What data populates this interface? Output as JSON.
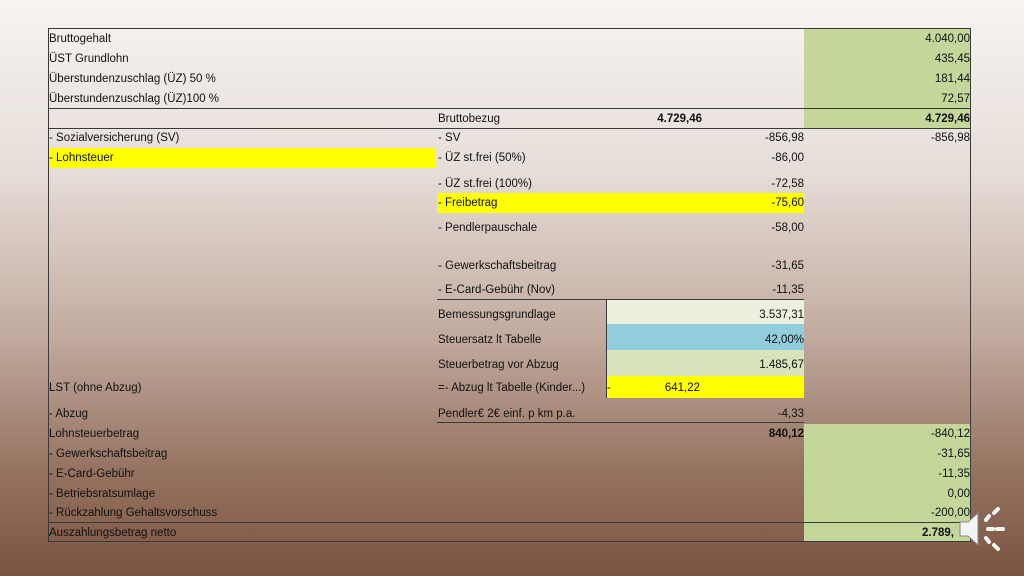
{
  "rows": {
    "brutto_label": "Bruttogehalt",
    "brutto_value": "4.040,00",
    "ust_label": "ÜST Grundlohn",
    "ust_value": "435,45",
    "uez50_label": "Überstundenzuschlag (ÜZ) 50 %",
    "uez50_value": "181,44",
    "uez100_label": "Überstundenzuschlag (ÜZ)100 %",
    "uez100_value": "72,57",
    "bruttobezug_label": "Bruttobezug",
    "bruttobezug_mid": "4.729,46",
    "bruttobezug_value": "4.729,46",
    "sv_label": "- Sozialversicherung (SV)",
    "sv_sub_label": "- SV",
    "sv_sub_value": "-856,98",
    "sv_value": "-856,98",
    "lohnsteuer_label": "- Lohnsteuer",
    "uez50frei_label": "- ÜZ st.frei (50%)",
    "uez50frei_value": "-86,00",
    "uez100frei_label": "- ÜZ st.frei (100%)",
    "uez100frei_value": "-72,58",
    "freibetrag_label": "- Freibetrag",
    "freibetrag_value": "-75,60",
    "pendler_label": "- Pendlerpauschale",
    "pendler_value": "-58,00",
    "gewerk_sub_label": "- Gewerkschaftsbeitrag",
    "gewerk_sub_value": "-31,65",
    "ecard_sub_label": "- E-Card-Gebühr (Nov)",
    "ecard_sub_value": "-11,35",
    "bemessung_label": "Bemessungsgrundlage",
    "bemessung_value": "3.537,31",
    "steuersatz_label": "Steuersatz lt Tabelle",
    "steuersatz_value": "42,00%",
    "steuerbetrag_label": "Steuerbetrag vor Abzug",
    "steuerbetrag_value": "1.485,67",
    "lst_label": "LST (ohne Abzug)",
    "abzug_tabelle_label": "=- Abzug lt Tabelle (Kinder...)",
    "abzug_tabelle_dash": "-",
    "abzug_tabelle_value": "641,22",
    "abzug_label": "- Abzug",
    "pendler_euro_label": "Pendler€ 2€ einf. p km p.a.",
    "pendler_euro_value": "-4,33",
    "lohnsteuerbetrag_label": "Lohnsteuerbetrag",
    "lohnsteuerbetrag_mid": "840,12",
    "lohnsteuerbetrag_value": "-840,12",
    "gewerk_label": "- Gewerkschaftsbeitrag",
    "gewerk_value": "-31,65",
    "ecard_label": "- E-Card-Gebühr",
    "ecard_value": "-11,35",
    "betriebsrat_label": "- Betriebsratsumlage",
    "betriebsrat_value": "0,00",
    "rueckzahlung_label": "- Rückzahlung Gehaltsvorschuss",
    "rueckzahlung_value": "-200,00",
    "auszahlung_label": "Auszahlungsbetrag netto",
    "auszahlung_value": "2.789,"
  },
  "icons": {
    "speaker": "speaker-icon"
  }
}
